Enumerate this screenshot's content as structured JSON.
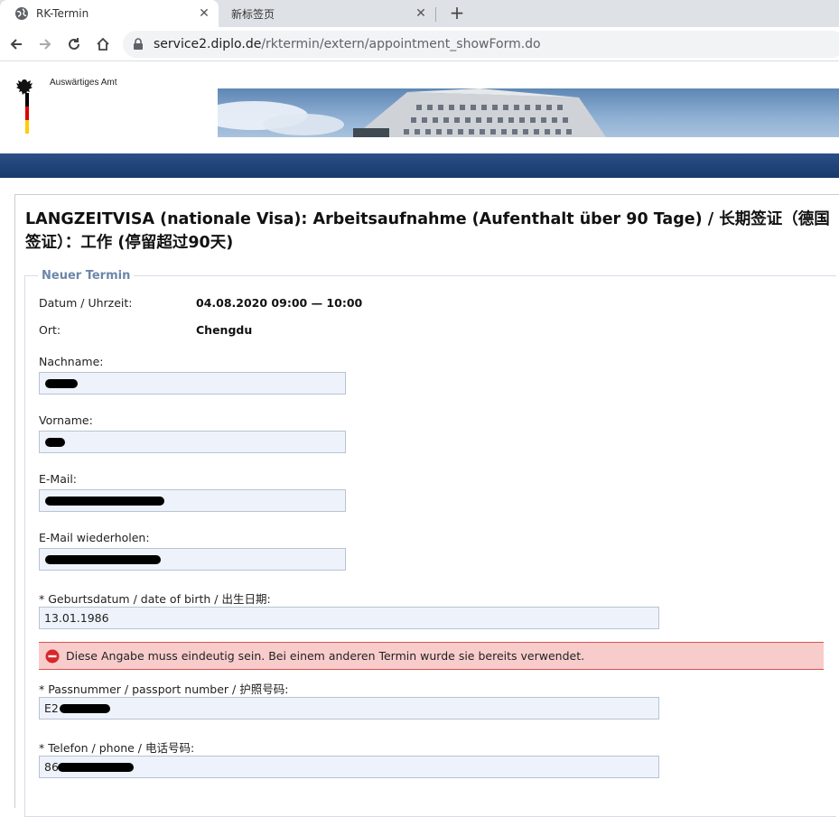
{
  "browser": {
    "tabs": [
      {
        "title": "RK-Termin",
        "active": true
      },
      {
        "title": "新标签页",
        "active": false
      }
    ],
    "url": {
      "host": "service2.diplo.de",
      "path": "/rktermin/extern/appointment_showForm.do"
    }
  },
  "header": {
    "ministry": "Auswärtiges Amt"
  },
  "main": {
    "title": "LANGZEITVISA (nationale Visa): Arbeitsaufnahme (Aufenthalt über 90 Tage) / 长期签证（德国签证）：工作 (停留超过90天)",
    "legend": "Neuer Termin",
    "date_label": "Datum / Uhrzeit:",
    "date_value": "04.08.2020 09:00 — 10:00",
    "place_label": "Ort:",
    "place_value": "Chengdu",
    "fields": {
      "lastname": {
        "label": "Nachname:",
        "value": ""
      },
      "firstname": {
        "label": "Vorname:",
        "value": ""
      },
      "email": {
        "label": "E-Mail:",
        "value": ""
      },
      "email_repeat": {
        "label": "E-Mail wiederholen:",
        "value": ""
      },
      "birthdate": {
        "label": "* Geburtsdatum / date of birth / 出生日期:",
        "value": "13.01.1986"
      },
      "passport": {
        "label": "* Passnummer / passport number / 护照号码:",
        "value": "E2"
      },
      "phone": {
        "label": "* Telefon / phone / 电话号码:",
        "value": "86"
      }
    },
    "error": "Diese Angabe muss eindeutig sein. Bei einem anderen Termin wurde sie bereits verwendet."
  },
  "colors": {
    "accent": "#6d86ab",
    "bluebar": "#1f4579",
    "error_bg": "#f9cccc",
    "error_border": "#d9534f",
    "input_bg": "#eef3fb"
  }
}
